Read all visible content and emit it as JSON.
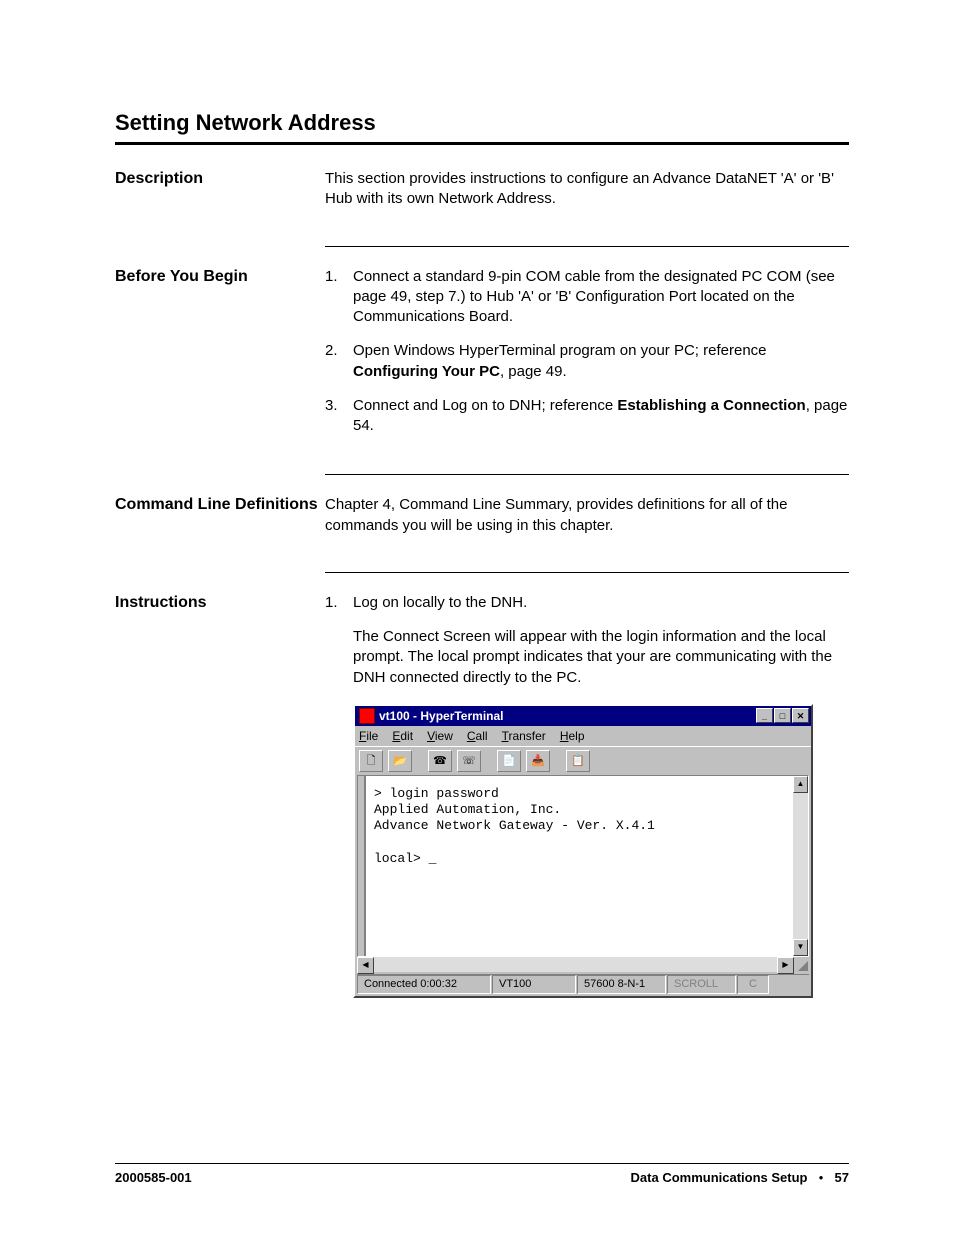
{
  "title": "Setting Network Address",
  "sections": {
    "description": {
      "heading": "Description",
      "body": "This section provides instructions to configure an Advance DataNET 'A' or 'B' Hub with its own Network Address."
    },
    "before": {
      "heading": "Before You Begin",
      "items": [
        "Connect a standard 9-pin COM cable from the designated PC COM (see page 49, step 7.) to Hub 'A' or 'B' Configuration Port located on the Communications Board.",
        {
          "pre": "Open Windows HyperTerminal program on your PC; reference ",
          "bold": "Configuring Your PC",
          "post": ", page 49."
        },
        {
          "pre": "Connect and Log on to DNH; reference ",
          "bold": "Establishing a Connection",
          "post": ", page 54."
        }
      ]
    },
    "cmddefs": {
      "heading": "Command Line Definitions",
      "body": "Chapter 4, Command Line Summary, provides definitions for all of the commands you will be using in this chapter."
    },
    "instructions": {
      "heading": "Instructions",
      "step1": "Log on locally to the DNH.",
      "step1_body": "The Connect Screen will appear with the login information and the local prompt. The local prompt indicates that your are communicating with the DNH connected directly to the PC."
    }
  },
  "hyperterminal": {
    "title": "vt100 - HyperTerminal",
    "menus": [
      "File",
      "Edit",
      "View",
      "Call",
      "Transfer",
      "Help"
    ],
    "terminal_lines": [
      "> login password",
      "Applied Automation, Inc.",
      "Advance Network Gateway - Ver. X.4.1",
      "",
      "local> _"
    ],
    "status": {
      "connected": "Connected 0:00:32",
      "emulation": "VT100",
      "settings": "57600 8-N-1",
      "scroll": "SCROLL",
      "cap": "C"
    }
  },
  "footer": {
    "docnum": "2000585-001",
    "section": "Data Communications Setup",
    "page": "57"
  }
}
